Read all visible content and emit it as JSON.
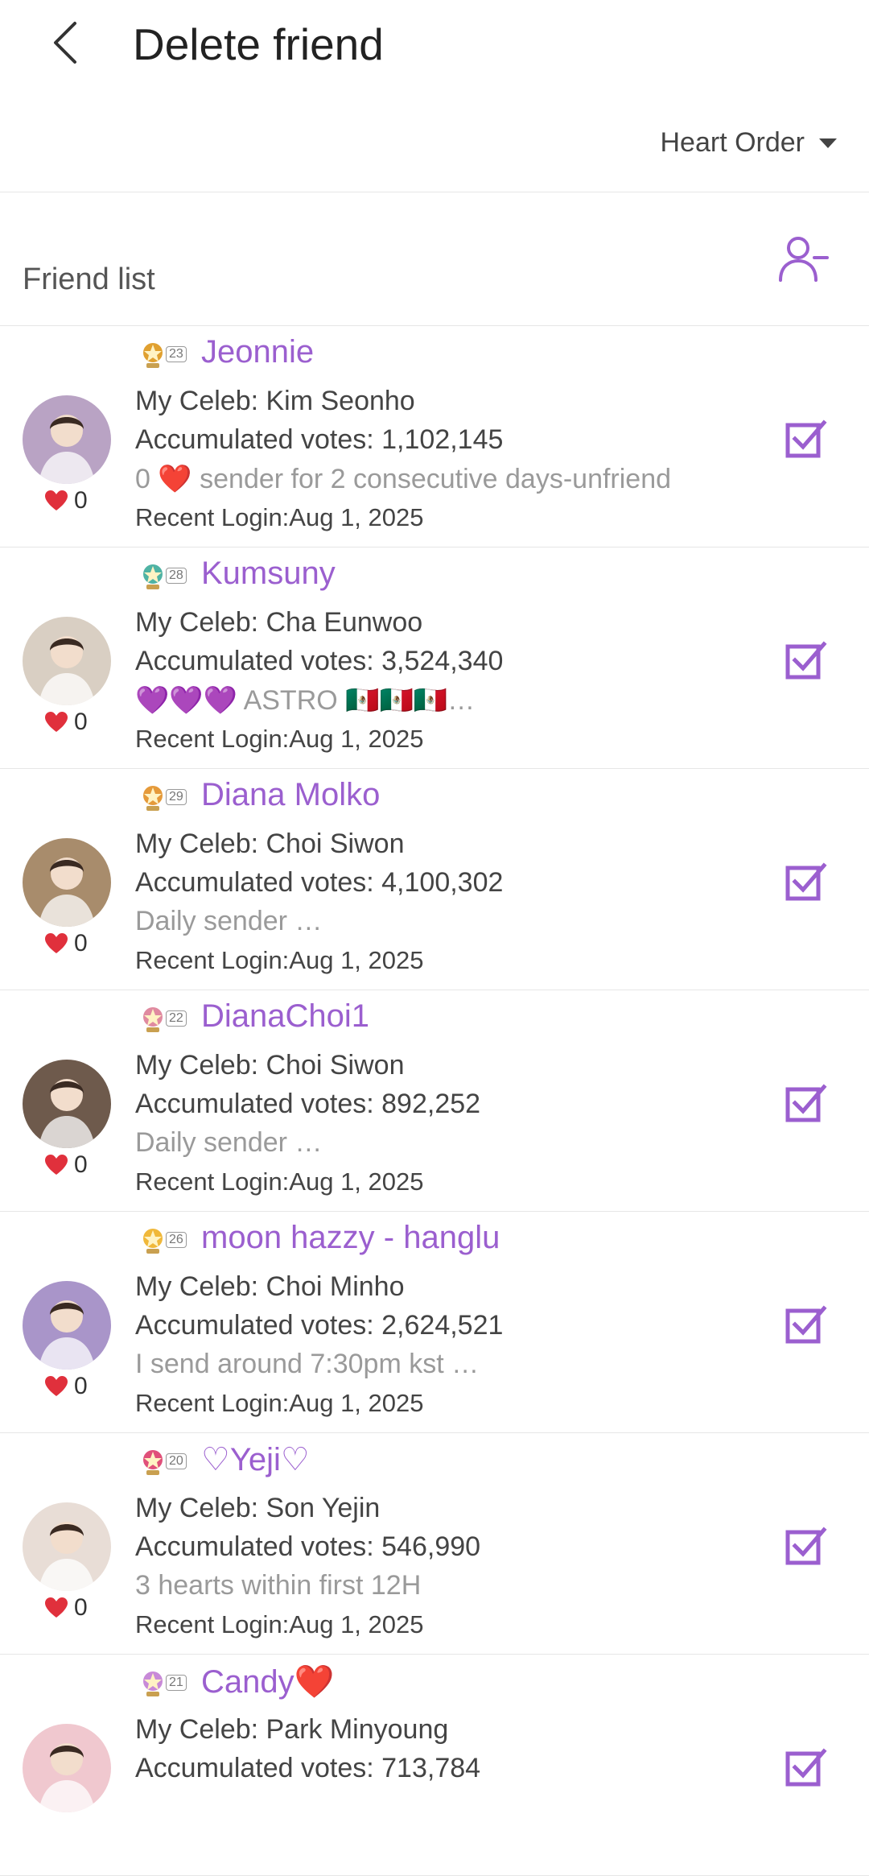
{
  "header": {
    "title": "Delete friend"
  },
  "sort": {
    "label": "Heart Order"
  },
  "list": {
    "label": "Friend list"
  },
  "friends": [
    {
      "level": "23",
      "name": "Jeonnie",
      "celeb": "My Celeb: Kim Seonho",
      "votes": "Accumulated votes: 1,102,145",
      "message": "0 ❤️ sender for 2 consecutive days-unfriend",
      "login": "Recent Login:Aug 1, 2025",
      "hearts": "0",
      "avatar_color": "#b9a3c4",
      "badge_color": "#e0a030"
    },
    {
      "level": "28",
      "name": "Kumsuny",
      "celeb": "My Celeb: Cha Eunwoo",
      "votes": "Accumulated votes: 3,524,340",
      "message": "💜💜💜 ASTRO 🇲🇽🇲🇽🇲🇽…",
      "login": "Recent Login:Aug 1, 2025",
      "hearts": "0",
      "avatar_color": "#d9cfc3",
      "badge_color": "#4fb3a4"
    },
    {
      "level": "29",
      "name": "Diana Molko",
      "celeb": "My Celeb: Choi Siwon",
      "votes": "Accumulated votes: 4,100,302",
      "message": "Daily sender …",
      "login": "Recent Login:Aug 1, 2025",
      "hearts": "0",
      "avatar_color": "#a88c6c",
      "badge_color": "#e59a3a"
    },
    {
      "level": "22",
      "name": "DianaChoi1",
      "celeb": "My Celeb: Choi Siwon",
      "votes": "Accumulated votes: 892,252",
      "message": "Daily sender …",
      "login": "Recent Login:Aug 1, 2025",
      "hearts": "0",
      "avatar_color": "#6e5a4c",
      "badge_color": "#e08aa0"
    },
    {
      "level": "26",
      "name": "moon hazzy - hanglu",
      "celeb": "My Celeb: Choi Minho",
      "votes": "Accumulated votes: 2,624,521",
      "message": "I send around 7:30pm kst …",
      "login": "Recent Login:Aug 1, 2025",
      "hearts": "0",
      "avatar_color": "#a995c9",
      "badge_color": "#f0b83a"
    },
    {
      "level": "20",
      "name": "♡Yeji♡",
      "celeb": "My Celeb: Son Yejin",
      "votes": "Accumulated votes: 546,990",
      "message": "3 hearts within first 12H",
      "login": "Recent Login:Aug 1, 2025",
      "hearts": "0",
      "avatar_color": "#e8ddd6",
      "badge_color": "#e0507a"
    },
    {
      "level": "21",
      "name": "Candy❤️",
      "celeb": "My Celeb: Park Minyoung",
      "votes": "Accumulated votes: 713,784",
      "message": "",
      "login": "",
      "hearts": "",
      "avatar_color": "#f0c8cf",
      "badge_color": "#c88ad8"
    }
  ],
  "colors": {
    "accent": "#9b5fcf",
    "heart": "#e0303c"
  },
  "icons": {
    "back": "back-arrow-icon",
    "sort": "caret-down-icon",
    "remove_user": "remove-user-icon",
    "check": "checkbox-checked-icon",
    "heart": "heart-icon"
  }
}
